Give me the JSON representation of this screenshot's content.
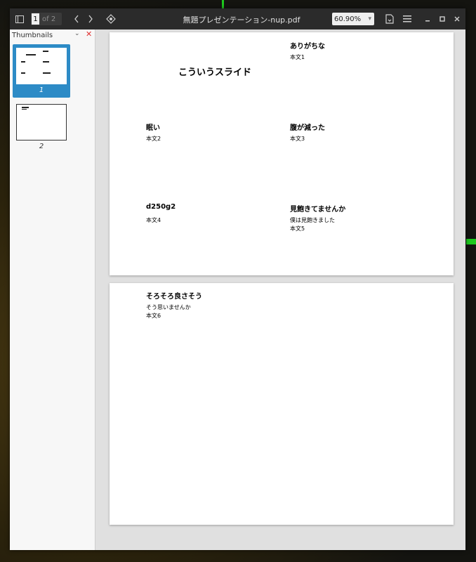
{
  "window": {
    "title": "無題プレゼンテーション-nup.pdf",
    "page_current": "1",
    "page_of": "of 2",
    "zoom": "60.90%"
  },
  "icons": {
    "sidebar_toggle": "sidebar-toggle-icon",
    "prev": "chevron-left-icon",
    "next": "chevron-right-icon",
    "locate": "locate-icon",
    "save": "document-save-icon",
    "menu": "hamburger-menu-icon",
    "minimize": "minimize-icon",
    "maximize": "maximize-icon",
    "close": "close-icon"
  },
  "sidebar": {
    "header": "Thumbnails",
    "thumbs": [
      {
        "label": "1",
        "selected": true
      },
      {
        "label": "2",
        "selected": false
      }
    ]
  },
  "page1": {
    "cover_title": "こういうスライド",
    "cells": [
      {
        "title": "ありがちな",
        "body": [
          "本文1"
        ]
      },
      {
        "title": "眠い",
        "body": [
          "本文2"
        ]
      },
      {
        "title": "腹が減った",
        "body": [
          "本文3"
        ]
      },
      {
        "title": "d250g2",
        "body": [
          "本文4"
        ]
      },
      {
        "title": "見飽きてませんか",
        "body": [
          "僕は見飽きました",
          "本文5"
        ]
      }
    ]
  },
  "page2": {
    "cells": [
      {
        "title": "そろそろ良さそう",
        "body": [
          "そう思いませんか",
          "本文6"
        ]
      }
    ]
  },
  "colors": {
    "titlebar": "#2b2b2b",
    "selection": "#2d8bc6",
    "close_red": "#e03030"
  }
}
